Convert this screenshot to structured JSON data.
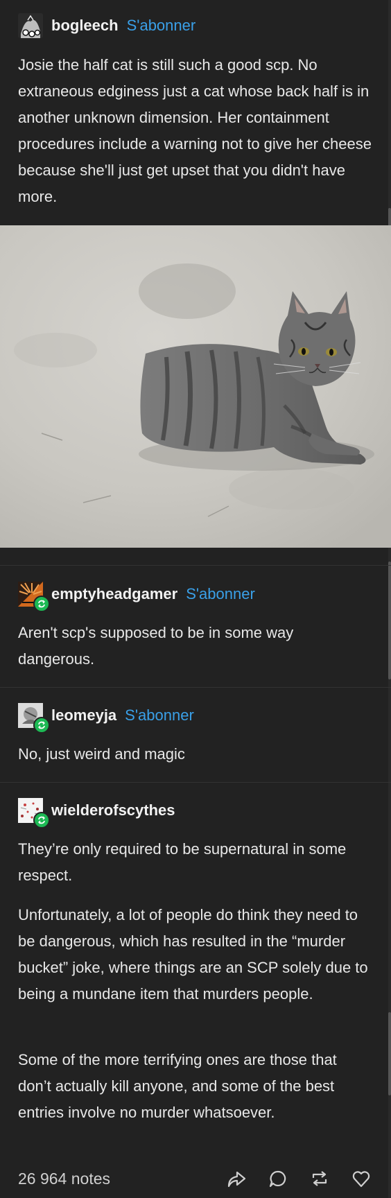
{
  "post": {
    "author": "bogleech",
    "follow_label": "S'abonner",
    "body": "Josie the half cat is still such a good scp. No extraneous edginess just a cat whose back half is in another unknown dimension. Her containment procedures include a warning not to give her cheese because she'll just get upset that you didn't have more."
  },
  "replies": [
    {
      "author": "emptyheadgamer",
      "follow_label": "S'abonner",
      "paragraphs": [
        "Aren't scp's supposed to be in some way dangerous."
      ]
    },
    {
      "author": "leomeyja",
      "follow_label": "S'abonner",
      "paragraphs": [
        "No, just weird and magic"
      ]
    },
    {
      "author": "wielderofscythes",
      "follow_label": "",
      "paragraphs": [
        "They’re only required to be supernatural in some respect.",
        "Unfortunately, a lot of people do think they need to be dangerous, which has resulted in the “murder bucket” joke, where things are an SCP solely due to being a mundane item that murders people.",
        "Some of the more terrifying ones are those that don’t actually kill anyone, and some of the best entries involve no murder whatsoever."
      ]
    }
  ],
  "footer": {
    "notes": "26 964 notes",
    "icons": [
      "share-icon",
      "comment-icon",
      "reblog-icon",
      "like-icon"
    ]
  },
  "colors": {
    "background": "#222222",
    "follow_link": "#3aa0e8",
    "reblog_badge": "#1db954"
  }
}
